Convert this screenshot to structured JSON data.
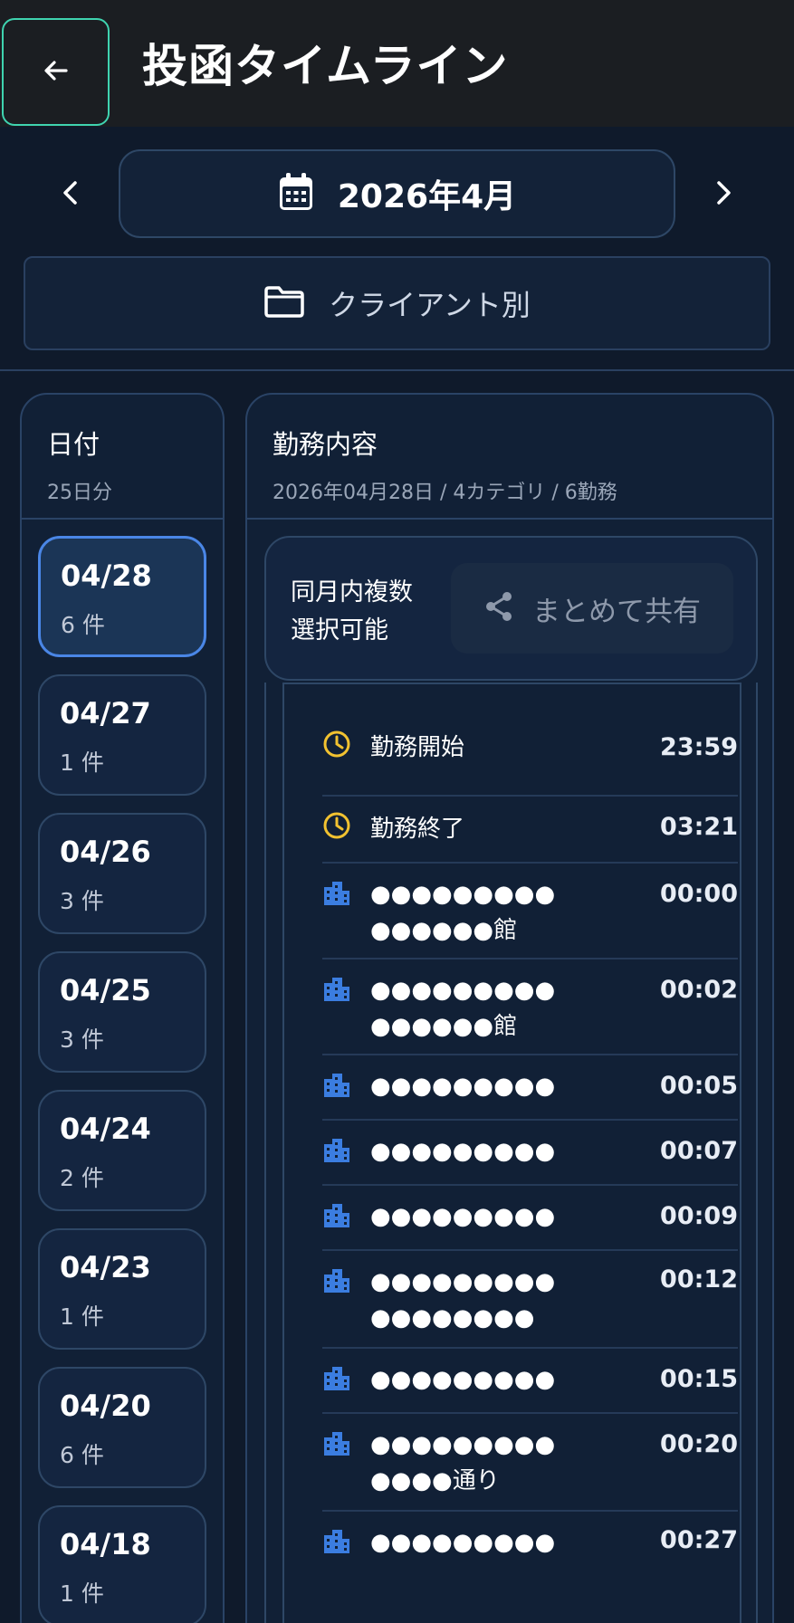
{
  "header": {
    "title": "投函タイムライン",
    "back_icon": "arrow-left-icon"
  },
  "month_nav": {
    "prev_icon": "chevron-left-icon",
    "next_icon": "chevron-right-icon",
    "calendar_icon": "calendar-icon",
    "label": "2026年4月"
  },
  "filter": {
    "icon": "folder-icon",
    "label": "クライアント別"
  },
  "date_panel": {
    "title": "日付",
    "subtitle": "25日分",
    "items": [
      {
        "date": "04/28",
        "count": "6 件",
        "selected": true
      },
      {
        "date": "04/27",
        "count": "1 件",
        "selected": false
      },
      {
        "date": "04/26",
        "count": "3 件",
        "selected": false
      },
      {
        "date": "04/25",
        "count": "3 件",
        "selected": false
      },
      {
        "date": "04/24",
        "count": "2 件",
        "selected": false
      },
      {
        "date": "04/23",
        "count": "1 件",
        "selected": false
      },
      {
        "date": "04/20",
        "count": "6 件",
        "selected": false
      },
      {
        "date": "04/18",
        "count": "1 件",
        "selected": false
      }
    ]
  },
  "work_panel": {
    "title": "勤務内容",
    "subtitle": "2026年04月28日 / 4カテゴリ / 6勤務",
    "multi_select_label": "同月内複数\n選択可能",
    "share_icon": "share-icon",
    "share_label": "まとめて共有",
    "timeline": [
      {
        "icon": "clock-icon",
        "name": "勤務開始",
        "time": "23:59"
      },
      {
        "icon": "clock-icon",
        "name": "勤務終了",
        "time": "03:21"
      },
      {
        "icon": "building-icon",
        "name": "●●●●●●●●●\n●●●●●●館",
        "time": "00:00"
      },
      {
        "icon": "building-icon",
        "name": "●●●●●●●●●\n●●●●●●館",
        "time": "00:02"
      },
      {
        "icon": "building-icon",
        "name": "●●●●●●●●●",
        "time": "00:05"
      },
      {
        "icon": "building-icon",
        "name": "●●●●●●●●●",
        "time": "00:07"
      },
      {
        "icon": "building-icon",
        "name": "●●●●●●●●●",
        "time": "00:09"
      },
      {
        "icon": "building-icon",
        "name": "●●●●●●●●●\n●●●●●●●●",
        "time": "00:12"
      },
      {
        "icon": "building-icon",
        "name": "●●●●●●●●●",
        "time": "00:15"
      },
      {
        "icon": "building-icon",
        "name": "●●●●●●●●●\n●●●●通り",
        "time": "00:20"
      },
      {
        "icon": "building-icon",
        "name": "●●●●●●●●●",
        "time": "00:27"
      }
    ]
  },
  "colors": {
    "accent_teal": "#3fd4b0",
    "selected_blue": "#4a86e6",
    "clock_yellow": "#f2c230",
    "building_blue": "#3b7de0"
  }
}
